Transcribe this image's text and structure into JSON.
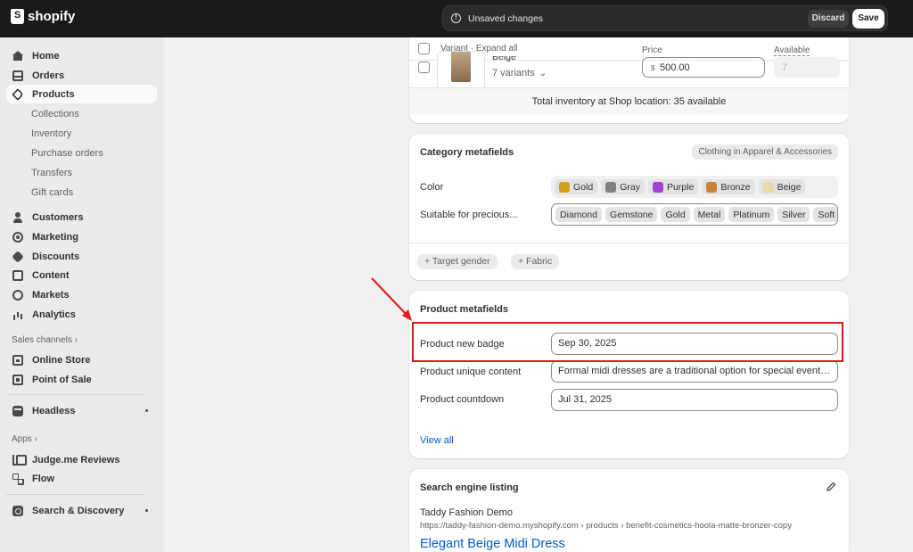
{
  "topbar": {
    "logo_text": "shopify",
    "unsaved_text": "Unsaved changes",
    "discard_label": "Discard",
    "save_label": "Save"
  },
  "sidebar": {
    "items": [
      {
        "label": "Home",
        "icon": "home-icon"
      },
      {
        "label": "Orders",
        "icon": "orders-icon"
      },
      {
        "label": "Products",
        "icon": "tag-icon",
        "active": true
      }
    ],
    "product_subitems": [
      "Collections",
      "Inventory",
      "Purchase orders",
      "Transfers",
      "Gift cards"
    ],
    "items2": [
      {
        "label": "Customers",
        "icon": "user-icon"
      },
      {
        "label": "Marketing",
        "icon": "target-icon"
      },
      {
        "label": "Discounts",
        "icon": "discount-icon"
      },
      {
        "label": "Content",
        "icon": "content-icon"
      },
      {
        "label": "Markets",
        "icon": "globe-icon"
      },
      {
        "label": "Analytics",
        "icon": "analytics-icon"
      }
    ],
    "sales_channels_label": "Sales channels",
    "channels": [
      {
        "label": "Online Store",
        "icon": "store-icon"
      },
      {
        "label": "Point of Sale",
        "icon": "pos-icon"
      }
    ],
    "headless_label": "Headless",
    "apps_label": "Apps",
    "apps": [
      {
        "label": "Judge.me Reviews",
        "icon": "judge-icon"
      },
      {
        "label": "Flow",
        "icon": "flow-icon"
      }
    ],
    "search_discovery_label": "Search & Discovery"
  },
  "variants": {
    "header_label": "Variant · Expand all",
    "price_header": "Price",
    "available_header": "Available",
    "row_name_partial": "Beige",
    "variants_count": "7 variants",
    "currency_symbol": "$",
    "price_value": "500.00",
    "available_value": "7",
    "total_inventory": "Total inventory at Shop location: 35 available"
  },
  "category_metafields": {
    "title": "Category metafields",
    "category_pill": "Clothing in Apparel & Accessories",
    "color_label": "Color",
    "colors": [
      {
        "name": "Gold",
        "hex": "#d4a017"
      },
      {
        "name": "Gray",
        "hex": "#808080"
      },
      {
        "name": "Purple",
        "hex": "#a63fd6"
      },
      {
        "name": "Bronze",
        "hex": "#cd7f32"
      },
      {
        "name": "Beige",
        "hex": "#e8d9a8"
      }
    ],
    "precious_label": "Suitable for precious...",
    "precious_values": [
      "Diamond",
      "Gemstone",
      "Gold",
      "Metal",
      "Platinum",
      "Silver",
      "Soft gem"
    ],
    "add_target_gender": "+ Target gender",
    "add_fabric": "+ Fabric"
  },
  "product_metafields": {
    "title": "Product metafields",
    "rows": [
      {
        "label": "Product new badge",
        "value": "Sep 30, 2025"
      },
      {
        "label": "Product unique content",
        "value": "Formal midi dresses are a traditional option for special events. ..."
      },
      {
        "label": "Product countdown",
        "value": "Jul 31, 2025"
      }
    ],
    "view_all": "View all"
  },
  "seo": {
    "title": "Search engine listing",
    "store_name": "Taddy Fashion Demo",
    "url": "https://taddy-fashion-demo.myshopify.com › products › benefit-cosmetics-hoola-matte-bronzer-copy",
    "page_title": "Elegant Beige Midi Dress"
  }
}
